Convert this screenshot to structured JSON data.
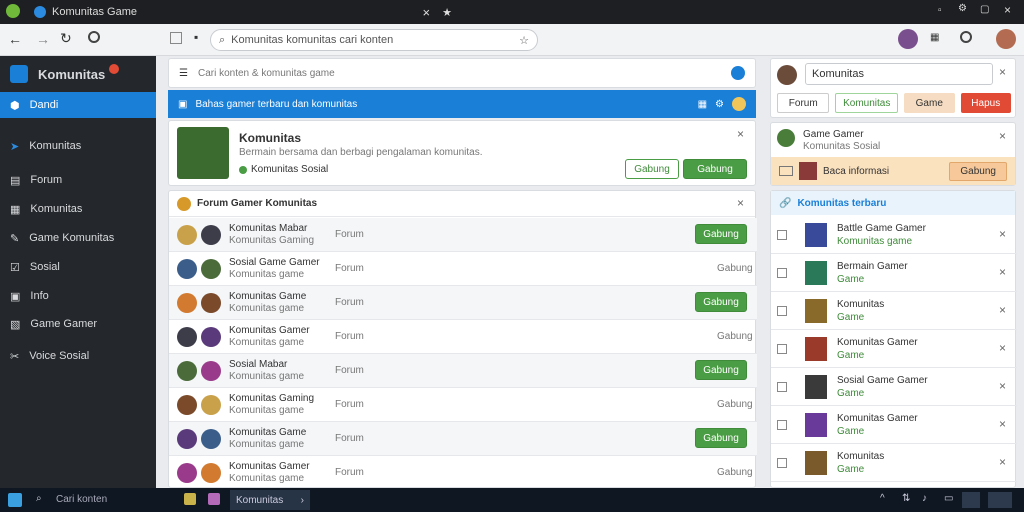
{
  "window": {
    "tab_title": "Komunitas Game"
  },
  "toolbar": {
    "address": "Komunitas komunitas cari konten"
  },
  "sidebar": {
    "brand": "Komunitas",
    "items": [
      "Dandi",
      "Komunitas",
      "Forum",
      "Komunitas",
      "Game Komunitas",
      "Sosial",
      "Info",
      "Game Gamer",
      "Voice Sosial"
    ]
  },
  "composer": {
    "placeholder": "Cari konten & komunitas game"
  },
  "banner": {
    "text": "Bahas gamer terbaru dan komunitas"
  },
  "profile": {
    "title": "Komunitas",
    "desc": "Bermain bersama dan berbagi pengalaman komunitas.",
    "meta": "Komunitas Sosial",
    "btn_outline": "Gabung",
    "btn_green": "Gabung"
  },
  "list": {
    "header": "Forum Gamer Komunitas",
    "rows": [
      {
        "name": "Komunitas Mabar",
        "sub": "Komunitas Gaming",
        "time": "Forum",
        "action": "Gabung",
        "btn": true
      },
      {
        "name": "Sosial Game Gamer",
        "sub": "Komunitas game",
        "time": "Forum",
        "action": "Gabung",
        "btn": false
      },
      {
        "name": "Komunitas Game",
        "sub": "Komunitas game",
        "time": "Forum",
        "action": "Gabung",
        "btn": true
      },
      {
        "name": "Komunitas Gamer",
        "sub": "Komunitas game",
        "time": "Forum",
        "action": "Gabung",
        "btn": false
      },
      {
        "name": "Sosial Mabar",
        "sub": "Komunitas game",
        "time": "Forum",
        "action": "Gabung",
        "btn": true
      },
      {
        "name": "Komunitas Gaming",
        "sub": "Komunitas game",
        "time": "Forum",
        "action": "Gabung",
        "btn": false
      },
      {
        "name": "Komunitas Game",
        "sub": "Komunitas game",
        "time": "Forum",
        "action": "Gabung",
        "btn": true
      },
      {
        "name": "Komunitas Gamer",
        "sub": "Komunitas game",
        "time": "Forum",
        "action": "Gabung",
        "btn": false
      }
    ]
  },
  "right": {
    "search": "Komunitas",
    "chips": [
      "Forum",
      "Komunitas",
      "Game",
      "Hapus"
    ],
    "user_name": "Game Gamer",
    "user_sub": "Komunitas Sosial",
    "user_note": "Baca informasi",
    "user_btn": "Gabung",
    "feed_title": "Komunitas terbaru",
    "items": [
      {
        "name": "Battle Game Gamer",
        "sub": "Komunitas game"
      },
      {
        "name": "Bermain Gamer",
        "sub": "Game"
      },
      {
        "name": "Komunitas",
        "sub": "Game"
      },
      {
        "name": "Komunitas Gamer",
        "sub": "Game"
      },
      {
        "name": "Sosial Game Gamer",
        "sub": "Game"
      },
      {
        "name": "Komunitas Gamer",
        "sub": "Game"
      },
      {
        "name": "Komunitas",
        "sub": "Game"
      }
    ]
  },
  "taskbar": {
    "search": "Cari konten",
    "app": "Komunitas"
  },
  "colors": {
    "accent": "#1a7fd7",
    "green": "#4a9d44",
    "red": "#e14b35",
    "warning": "#fbe2bf"
  }
}
